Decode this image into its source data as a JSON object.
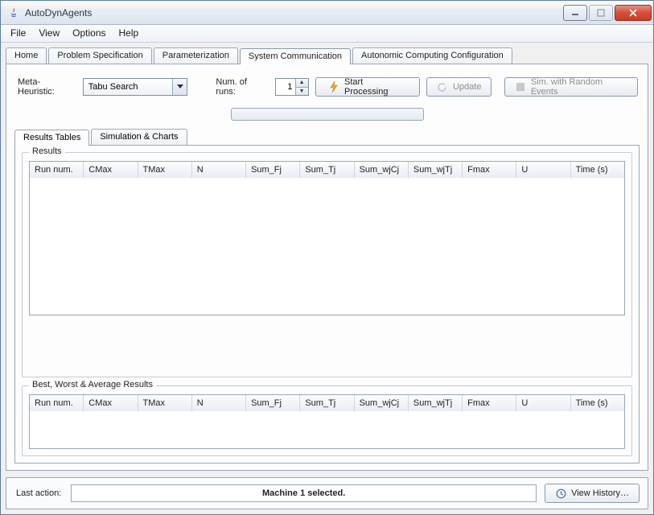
{
  "window": {
    "title": "AutoDynAgents"
  },
  "menu": {
    "items": [
      "File",
      "View",
      "Options",
      "Help"
    ]
  },
  "tabs": {
    "items": [
      "Home",
      "Problem Specification",
      "Parameterization",
      "System Communication",
      "Autonomic Computing Configuration"
    ],
    "activeIndex": 3
  },
  "controls": {
    "metaLabel": "Meta-Heuristic:",
    "metaValue": "Tabu Search",
    "numRunsLabel": "Num. of runs:",
    "numRunsValue": "1",
    "startLabel": "Start Processing",
    "updateLabel": "Update",
    "simLabel": "Sim. with Random Events"
  },
  "subtabs": {
    "items": [
      "Results Tables",
      "Simulation & Charts"
    ],
    "activeIndex": 0
  },
  "groups": {
    "results": "Results",
    "bwa": "Best, Worst & Average Results"
  },
  "columns": [
    "Run num.",
    "CMax",
    "TMax",
    "N",
    "Sum_Fj",
    "Sum_Tj",
    "Sum_wjCj",
    "Sum_wjTj",
    "Fmax",
    "U",
    "Time (s)"
  ],
  "status": {
    "label": "Last action:",
    "message": "Machine 1 selected.",
    "historyLabel": "View History…"
  }
}
